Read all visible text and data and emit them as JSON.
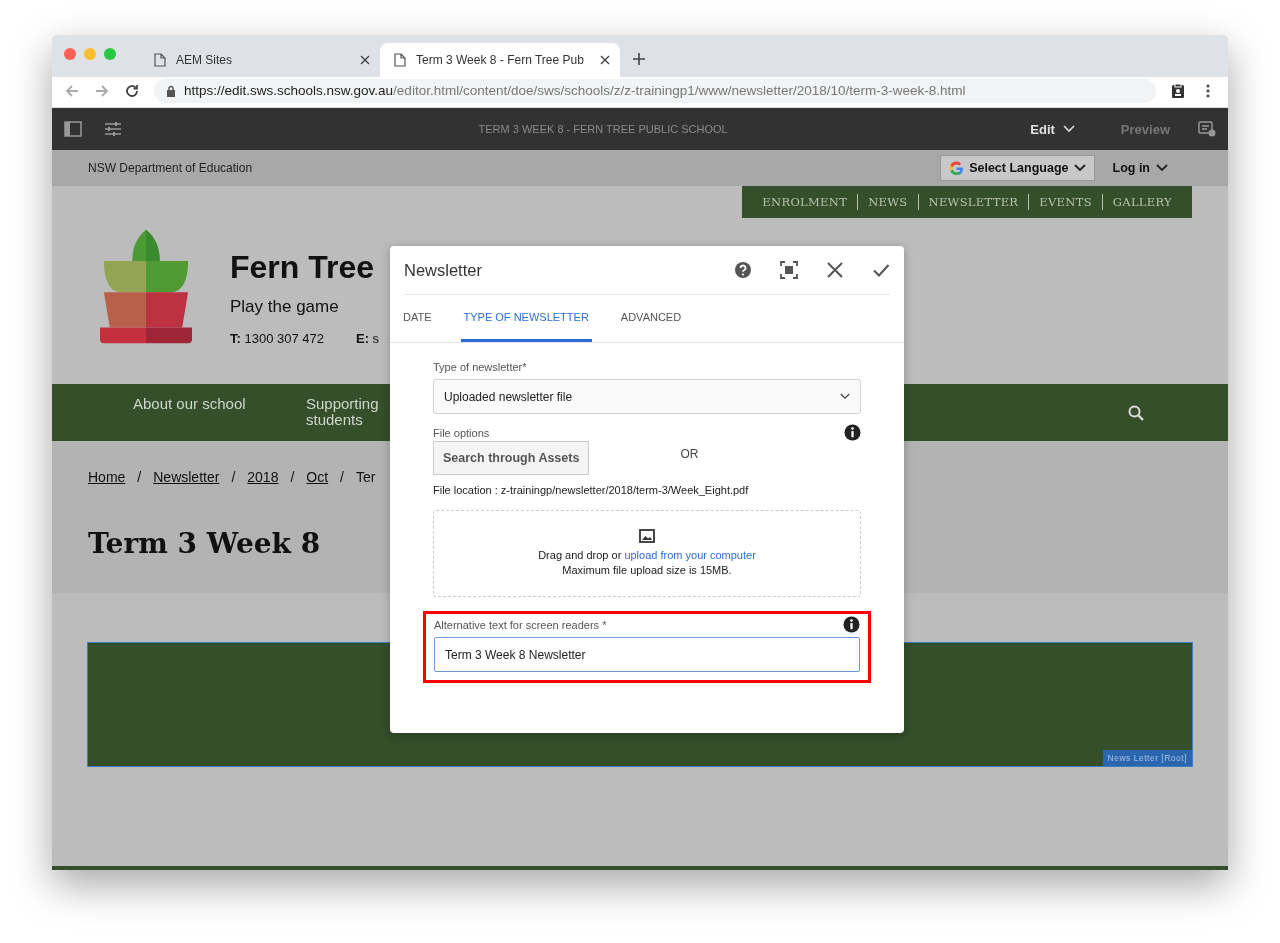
{
  "browser": {
    "tabs": [
      {
        "title": "AEM Sites",
        "selected": false
      },
      {
        "title": "Term 3 Week 8 - Fern Tree Pub",
        "selected": true
      }
    ],
    "url": {
      "host": "https://edit.sws.schools.nsw.gov.au",
      "path": "/editor.html/content/doe/sws/schools/z/z-trainingp1/www/newsletter/2018/10/term-3-week-8.html"
    }
  },
  "editor_toolbar": {
    "title": "TERM 3 WEEK 8 - FERN TREE PUBLIC SCHOOL",
    "mode": "Edit",
    "preview": "Preview"
  },
  "site": {
    "org": "NSW Department of Education",
    "language_button": "Select Language",
    "login": "Log in",
    "quick_links": [
      "ENROLMENT",
      "NEWS",
      "NEWSLETTER",
      "EVENTS",
      "GALLERY"
    ],
    "school_name": "Fern Tree",
    "tagline": "Play the game",
    "contacts": [
      {
        "label": "T:",
        "value": "1300 307 472"
      },
      {
        "label": "E:",
        "value": "s"
      }
    ],
    "main_nav": [
      "About our school",
      "Supporting students"
    ],
    "breadcrumb": [
      {
        "label": "Home",
        "link": true
      },
      {
        "separator": "/",
        "label": "Newsletter",
        "link": true
      },
      {
        "separator": "/",
        "label": "2018",
        "link": true
      },
      {
        "separator": "/",
        "label": "Oct",
        "link": true
      },
      {
        "separator": "/",
        "label": "Ter",
        "link": false
      }
    ],
    "page_title": "Term 3 Week 8",
    "component_label": "News Letter [Root]"
  },
  "dialog": {
    "title": "Newsletter",
    "tabs": [
      {
        "label": "DATE",
        "selected": false
      },
      {
        "label": "TYPE OF NEWSLETTER",
        "selected": true
      },
      {
        "label": "ADVANCED",
        "selected": false
      }
    ],
    "type_label": "Type of newsletter*",
    "type_value": "Uploaded newsletter file",
    "file_options_label": "File options",
    "search_button": "Search through Assets",
    "or_text": "OR",
    "file_location": "File location : z-trainingp/newsletter/2018/term-3/Week_Eight.pdf",
    "dropzone": {
      "text": "Drag and drop or",
      "link": "upload from your computer",
      "limit": "Maximum file upload size is 15MB."
    },
    "alt_text": {
      "label": "Alternative text for screen readers *",
      "value": "Term 3 Week 8 Newsletter",
      "highlighted": true
    }
  }
}
